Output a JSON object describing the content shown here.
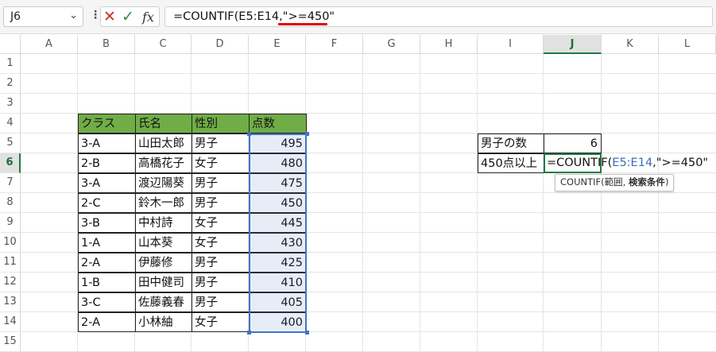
{
  "name_box": {
    "value": "J6"
  },
  "formula_bar": {
    "buttons": {
      "cancel": "✕",
      "enter": "✓",
      "fx": "fx"
    },
    "formula": "=COUNTIF(E5:E14,\">=450\""
  },
  "sheet": {
    "columns": [
      "A",
      "B",
      "C",
      "D",
      "E",
      "F",
      "G",
      "H",
      "I",
      "J",
      "K",
      "L"
    ],
    "active_column": "J",
    "rows": [
      "1",
      "2",
      "3",
      "4",
      "5",
      "6",
      "7",
      "8",
      "9",
      "10",
      "11",
      "12",
      "13",
      "14",
      "15"
    ],
    "active_row": "6"
  },
  "table": {
    "headers": [
      "クラス",
      "氏名",
      "性別",
      "点数"
    ],
    "rows": [
      [
        "3-A",
        "山田太郎",
        "男子",
        "495"
      ],
      [
        "2-B",
        "高橋花子",
        "女子",
        "480"
      ],
      [
        "3-A",
        "渡辺陽葵",
        "男子",
        "475"
      ],
      [
        "2-C",
        "鈴木一郎",
        "男子",
        "450"
      ],
      [
        "3-B",
        "中村詩",
        "女子",
        "445"
      ],
      [
        "1-A",
        "山本葵",
        "女子",
        "430"
      ],
      [
        "2-A",
        "伊藤修",
        "男子",
        "425"
      ],
      [
        "1-B",
        "田中健司",
        "男子",
        "410"
      ],
      [
        "3-C",
        "佐藤義春",
        "男子",
        "405"
      ],
      [
        "2-A",
        "小林紬",
        "女子",
        "400"
      ]
    ],
    "header_color": "#70ad47"
  },
  "summary": {
    "label1": "男子の数",
    "value1": "6",
    "label2": "450点以上",
    "edit_formula_prefix": "=COUNTIF(",
    "edit_formula_ref": "E5:E14",
    "edit_formula_suffix": ",\">=450\""
  },
  "tooltip": {
    "prefix": "COUNTIF(範囲, ",
    "bold": "検索条件",
    "suffix": ")"
  },
  "colors": {
    "accent_green": "#1d7b44",
    "range_blue": "#4472c4",
    "underline_red": "#e00000"
  }
}
